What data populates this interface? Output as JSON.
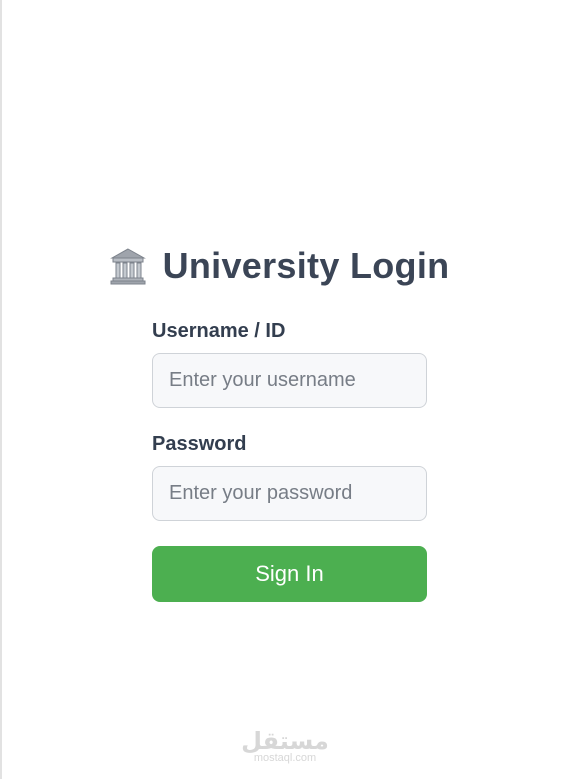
{
  "login": {
    "title": "University Login",
    "title_icon": "university-building-icon",
    "username": {
      "label": "Username / ID",
      "placeholder": "Enter your username",
      "value": ""
    },
    "password": {
      "label": "Password",
      "placeholder": "Enter your password",
      "value": ""
    },
    "submit_label": "Sign In"
  },
  "watermark": {
    "logo": "مستقل",
    "text": "mostaql.com"
  },
  "colors": {
    "title": "#3b4556",
    "button": "#4caf50",
    "input_background": "#f7f8fa",
    "input_border": "#cfd3d8"
  }
}
